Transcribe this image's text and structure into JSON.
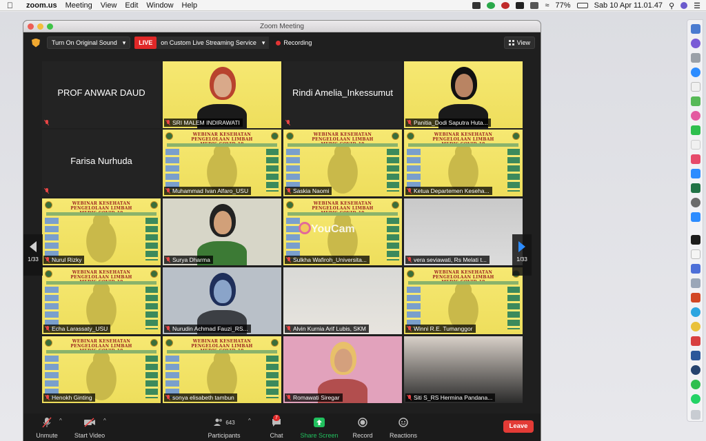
{
  "menubar": {
    "app_name": "zoom.us",
    "items": [
      "Meeting",
      "View",
      "Edit",
      "Window",
      "Help"
    ],
    "battery": "77%",
    "datetime": "Sab 10 Apr  11.01.47"
  },
  "window": {
    "title": "Zoom Meeting"
  },
  "topbar": {
    "original_sound": "Turn On Original Sound",
    "live_badge": "LIVE",
    "stream_label": "on Custom Live Streaming Service",
    "recording_label": "Recording",
    "view_label": "View"
  },
  "pagination": {
    "left": "1/33",
    "right": "1/33"
  },
  "poster": {
    "title_line1": "WEBINAR KESEHATAN",
    "title_line2": "PENGELOLAAN LIMBAH",
    "title_line3": "MEDIS COVID-19"
  },
  "participants": [
    {
      "name": "PROF ANWAR DAUD",
      "type": "name"
    },
    {
      "name": "SRI MALEM INDIRAWATI",
      "type": "video"
    },
    {
      "name": "Rindi Amelia_Inkessumut",
      "type": "name"
    },
    {
      "name": "Panitia_Dodi Saputra Huta...",
      "type": "video"
    },
    {
      "name": "Farisa Nurhuda",
      "type": "name"
    },
    {
      "name": "Muhammad Ivan Alfaro_USU",
      "type": "poster"
    },
    {
      "name": "Saskia Naomi",
      "type": "poster"
    },
    {
      "name": "Ketua Departemen Keseha...",
      "type": "poster"
    },
    {
      "name": "Nurul Rizky",
      "type": "poster"
    },
    {
      "name": "Surya Dharma",
      "type": "video"
    },
    {
      "name": "Sulkha Wafiroh_Universita...",
      "type": "poster"
    },
    {
      "name": "vera seviawati, Rs Melati t...",
      "type": "video"
    },
    {
      "name": "Echa Larassaty_USU",
      "type": "poster"
    },
    {
      "name": "Nurudin Achmad Fauzi_RS...",
      "type": "video"
    },
    {
      "name": "Alvin Kurnia Arif Lubis, SKM",
      "type": "video"
    },
    {
      "name": "Winni R.E. Tumanggor",
      "type": "poster"
    },
    {
      "name": "Henokh Ginting",
      "type": "poster"
    },
    {
      "name": "sonya elisabeth tambun",
      "type": "poster"
    },
    {
      "name": "Romawati Siregar",
      "type": "video"
    },
    {
      "name": "Siti S_RS Hermina Pandana...",
      "type": "video"
    }
  ],
  "watermark": "YouCam",
  "toolbar": {
    "unmute": "Unmute",
    "start_video": "Start Video",
    "participants": "Participants",
    "participants_count": "643",
    "chat": "Chat",
    "chat_badge": "7",
    "share_screen": "Share Screen",
    "record": "Record",
    "reactions": "Reactions",
    "leave": "Leave"
  }
}
